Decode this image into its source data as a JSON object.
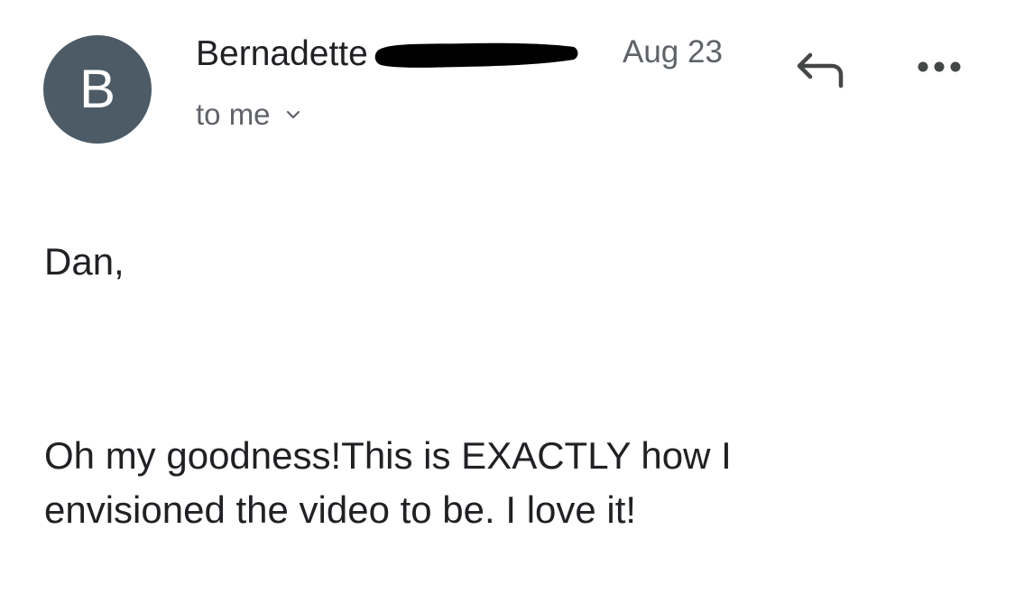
{
  "sender": {
    "avatar_letter": "B",
    "name": "Bernadette",
    "avatar_color": "#4d5b66"
  },
  "date": "Aug 23",
  "recipient": "to me",
  "actions": {
    "reply_icon": "reply-icon",
    "more_icon": "more-options-icon"
  },
  "message": {
    "greeting": "Dan,",
    "line1": "Oh my goodness!This is EXACTLY how I",
    "line2": "envisioned the video to be. I love it!"
  }
}
